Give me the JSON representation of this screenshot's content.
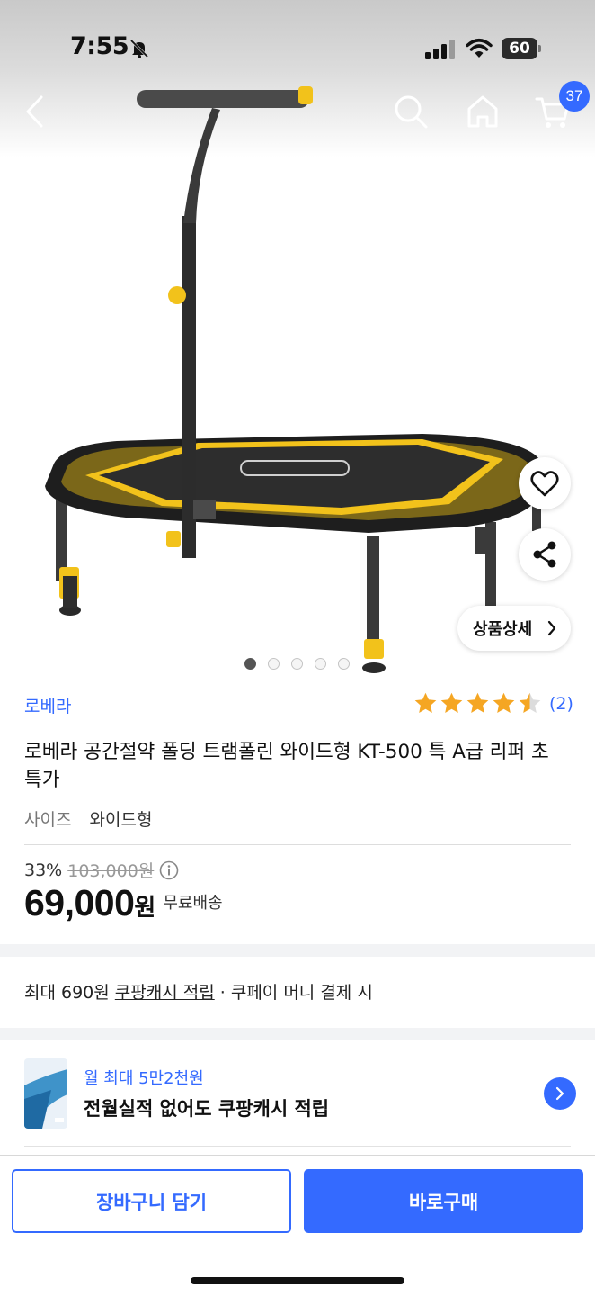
{
  "status_bar": {
    "time": "7:55",
    "battery": "60"
  },
  "nav": {
    "cart_count": "37"
  },
  "gallery": {
    "image_count": 5,
    "active_index": 0,
    "detail_label": "상품상세"
  },
  "product": {
    "brand": "로베라",
    "rating": 4.5,
    "review_count": "(2)",
    "title": "로베라 공간절약 폴딩 트램폴린 와이드형 KT-500 특 A급 리퍼 초특가",
    "option_label": "사이즈",
    "option_value": "와이드형",
    "discount_rate": "33%",
    "original_price": "103,000원",
    "sale_price": "69,000",
    "currency": "원",
    "shipping": "무료배송"
  },
  "cashback": {
    "prefix": "최대 690원 ",
    "link": "쿠팡캐시 적립",
    "suffix": " · 쿠페이 머니 결제 시"
  },
  "card_promo": {
    "subtitle": "월 최대 5만2천원",
    "title": "전월실적 없어도 쿠팡캐시 적립"
  },
  "actions": {
    "add_to_cart": "장바구니 담기",
    "buy_now": "바로구매"
  },
  "colors": {
    "accent": "#346aff",
    "star": "#f5a623",
    "product_yellow": "#f2c21b"
  },
  "icons": [
    "back-icon",
    "search-icon",
    "home-icon",
    "cart-icon",
    "heart-icon",
    "share-icon",
    "chevron-right-icon",
    "info-icon"
  ]
}
